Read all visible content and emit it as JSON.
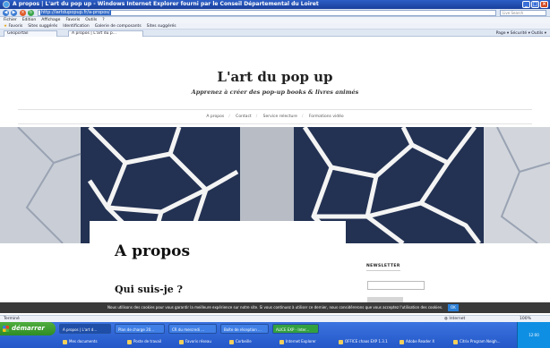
{
  "window": {
    "title": "A propos | L'art du pop up - Windows Internet Explorer fourni par le Conseil Départemental du Loiret"
  },
  "addressbar": {
    "url": "http://lartdupopup.fr/a-propos/",
    "search_placeholder": "Live Search"
  },
  "menubar": {
    "items": [
      "Fichier",
      "Edition",
      "Affichage",
      "Favoris",
      "Outils",
      "?"
    ]
  },
  "favbar": {
    "items": [
      "Favoris",
      "Sites suggérés",
      "Identification",
      "Galerie de composants",
      "Sites suggérés"
    ]
  },
  "tabs": [
    {
      "label": "Géoportail"
    },
    {
      "label": "A propos | L'art du p..."
    }
  ],
  "toolbar": {
    "tools": "Page ▾   Sécurité ▾   Outils ▾"
  },
  "site": {
    "title": "L'art du pop up",
    "tagline": "Apprenez à créer des pop-up books & livres animés",
    "nav": [
      "A propos",
      "Contact",
      "Service relecture",
      "Formations vidéo"
    ]
  },
  "content": {
    "h1": "A propos",
    "h2": "Qui suis-je ?"
  },
  "sidebar": {
    "newsletter_title": "NEWSLETTER"
  },
  "cookie": {
    "text": "Nous utilisons des cookies pour vous garantir la meilleure expérience sur notre site. Si vous continuez à utiliser ce dernier, nous considérerons que vous acceptez l'utilisation des cookies.",
    "ok": "OK"
  },
  "statusbar": {
    "text": "Terminé",
    "zone": "Internet",
    "zoom": "100%"
  },
  "taskbar": {
    "start": "démarrer",
    "tasks": [
      {
        "label": "A propos | L'art d..."
      },
      {
        "label": "Plan de charge 20..."
      },
      {
        "label": "CR du mercredi ..."
      },
      {
        "label": "Boîte de réception ..."
      },
      {
        "label": "ALICE EXP - Inter..."
      }
    ],
    "quicklaunch": [
      "Mes documents",
      "Poste de travail",
      "Favoris réseau",
      "Corbeille",
      "Internet Explorer",
      "OFFICE chaos EXP 1.3.1",
      "Adobe Reader X",
      "Citrix Program Neigh..."
    ],
    "clock": "12:00"
  }
}
